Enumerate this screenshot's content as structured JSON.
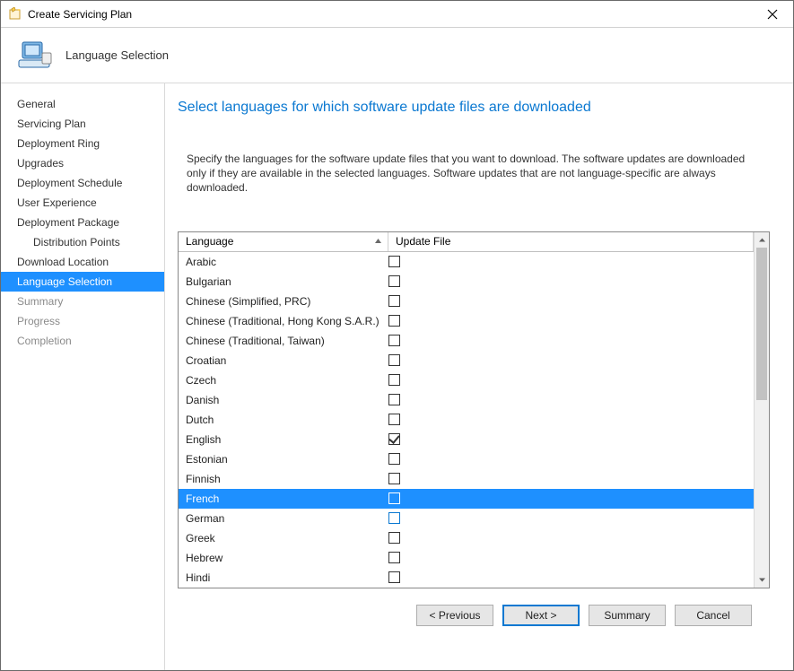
{
  "window": {
    "title": "Create Servicing Plan"
  },
  "header": {
    "pagetitle": "Language Selection"
  },
  "sidebar": {
    "items": [
      {
        "label": "General",
        "indent": false
      },
      {
        "label": "Servicing Plan",
        "indent": false
      },
      {
        "label": "Deployment Ring",
        "indent": false
      },
      {
        "label": "Upgrades",
        "indent": false
      },
      {
        "label": "Deployment Schedule",
        "indent": false
      },
      {
        "label": "User Experience",
        "indent": false
      },
      {
        "label": "Deployment Package",
        "indent": false
      },
      {
        "label": "Distribution Points",
        "indent": true
      },
      {
        "label": "Download Location",
        "indent": false
      },
      {
        "label": "Language Selection",
        "indent": false,
        "selected": true
      },
      {
        "label": "Summary",
        "indent": false,
        "dim": true
      },
      {
        "label": "Progress",
        "indent": false,
        "dim": true
      },
      {
        "label": "Completion",
        "indent": false,
        "dim": true
      }
    ]
  },
  "content": {
    "heading": "Select languages for which software update files are downloaded",
    "description": "Specify the languages for the software update files that you want to download. The software updates are downloaded only if they are available in the selected languages. Software updates that are not language-specific are always downloaded."
  },
  "table": {
    "col_language": "Language",
    "col_updatefile": "Update File",
    "rows": [
      {
        "language": "Arabic",
        "checked": false
      },
      {
        "language": "Bulgarian",
        "checked": false
      },
      {
        "language": "Chinese (Simplified, PRC)",
        "checked": false
      },
      {
        "language": "Chinese (Traditional, Hong Kong S.A.R.)",
        "checked": false
      },
      {
        "language": "Chinese (Traditional, Taiwan)",
        "checked": false
      },
      {
        "language": "Croatian",
        "checked": false
      },
      {
        "language": "Czech",
        "checked": false
      },
      {
        "language": "Danish",
        "checked": false
      },
      {
        "language": "Dutch",
        "checked": false
      },
      {
        "language": "English",
        "checked": true
      },
      {
        "language": "Estonian",
        "checked": false
      },
      {
        "language": "Finnish",
        "checked": false
      },
      {
        "language": "French",
        "checked": false,
        "selected": true
      },
      {
        "language": "German",
        "checked": false,
        "active": true
      },
      {
        "language": "Greek",
        "checked": false
      },
      {
        "language": "Hebrew",
        "checked": false
      },
      {
        "language": "Hindi",
        "checked": false
      }
    ]
  },
  "footer": {
    "previous": "< Previous",
    "next": "Next >",
    "summary": "Summary",
    "cancel": "Cancel"
  }
}
